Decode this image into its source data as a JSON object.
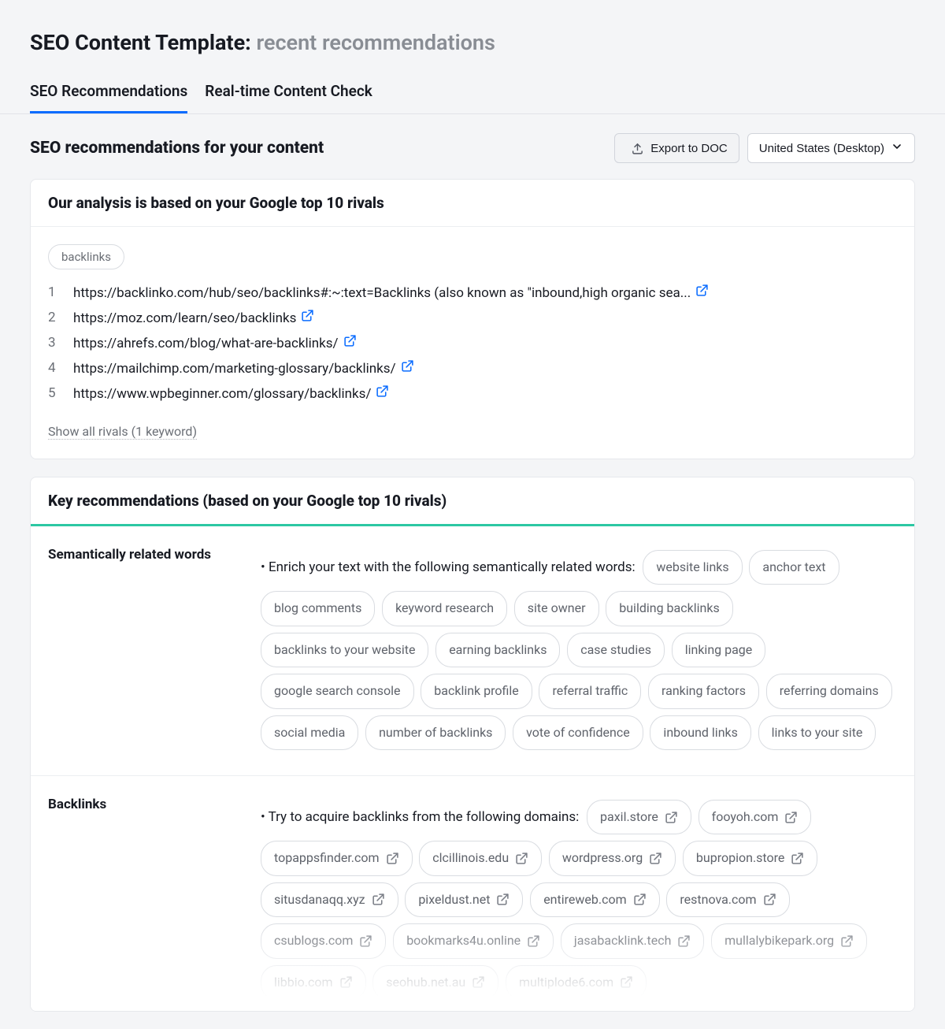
{
  "header": {
    "title": "SEO Content Template:",
    "subtitle": "recent recommendations"
  },
  "tabs": [
    {
      "label": "SEO Recommendations",
      "active": true
    },
    {
      "label": "Real-time Content Check",
      "active": false
    }
  ],
  "subheader": {
    "title": "SEO recommendations for your content",
    "export_label": "Export to DOC",
    "region_label": "United States (Desktop)"
  },
  "rivals_card": {
    "title": "Our analysis is based on your Google top 10 rivals",
    "keyword_chip": "backlinks",
    "items": [
      {
        "n": "1",
        "url": "https://backlinko.com/hub/seo/backlinks#:~:text=Backlinks (also known as \"inbound,high organic sea..."
      },
      {
        "n": "2",
        "url": "https://moz.com/learn/seo/backlinks"
      },
      {
        "n": "3",
        "url": "https://ahrefs.com/blog/what-are-backlinks/"
      },
      {
        "n": "4",
        "url": "https://mailchimp.com/marketing-glossary/backlinks/"
      },
      {
        "n": "5",
        "url": "https://www.wpbeginner.com/glossary/backlinks/"
      }
    ],
    "show_all": "Show all rivals (1 keyword)"
  },
  "keyrec": {
    "title": "Key recommendations (based on your Google top 10 rivals)",
    "semantic": {
      "label": "Semantically related words",
      "lead": "Enrich your text with the following semantically related words:",
      "words": [
        "website links",
        "anchor text",
        "blog comments",
        "keyword research",
        "site owner",
        "building backlinks",
        "backlinks to your website",
        "earning backlinks",
        "case studies",
        "linking page",
        "google search console",
        "backlink profile",
        "referral traffic",
        "ranking factors",
        "referring domains",
        "social media",
        "number of backlinks",
        "vote of confidence",
        "inbound links",
        "links to your site"
      ]
    },
    "backlinks": {
      "label": "Backlinks",
      "lead": "Try to acquire backlinks from the following domains:",
      "domains": [
        "paxil.store",
        "fooyoh.com",
        "topappsfinder.com",
        "clcillinois.edu",
        "wordpress.org",
        "bupropion.store",
        "situsdanaqq.xyz",
        "pixeldust.net",
        "entireweb.com",
        "restnova.com",
        "csublogs.com",
        "bookmarks4u.online",
        "jasabacklink.tech",
        "mullalybikepark.org",
        "libbio.com",
        "seohub.net.au",
        "multiplode6.com"
      ]
    }
  }
}
